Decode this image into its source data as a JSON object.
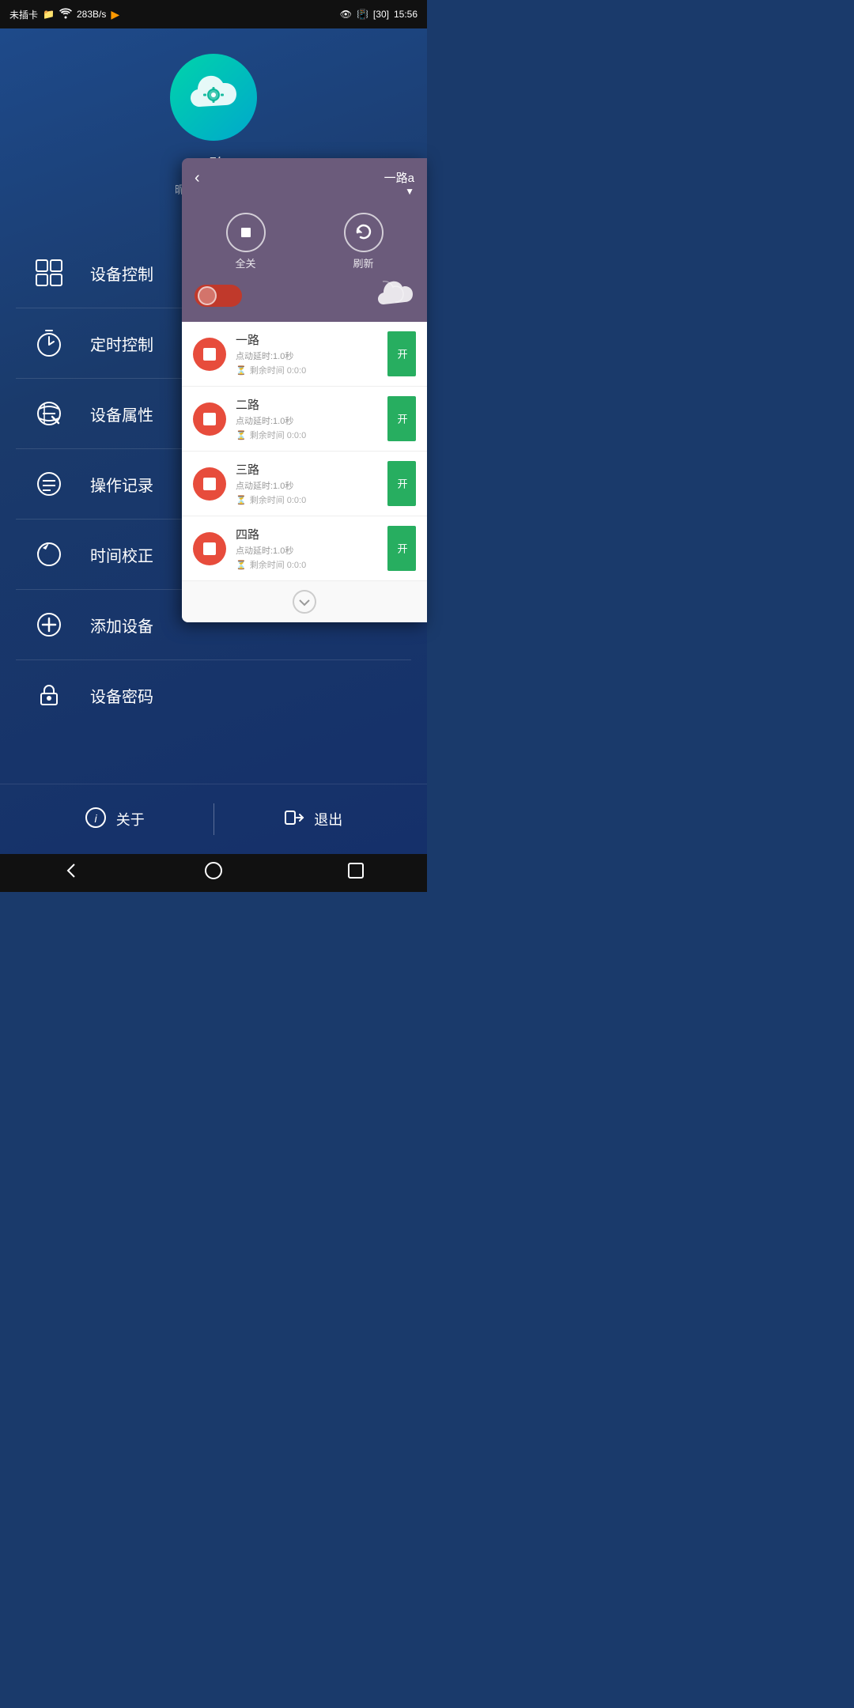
{
  "statusBar": {
    "left": "未插卡",
    "speed": "283B/s",
    "time": "15:56",
    "battery": "30"
  },
  "profile": {
    "name": "一路a",
    "nickname": "昵称：我的设备",
    "chevron": "∨"
  },
  "menuItems": [
    {
      "id": "device-control",
      "label": "设备控制"
    },
    {
      "id": "timer-control",
      "label": "定时控制"
    },
    {
      "id": "device-properties",
      "label": "设备属性"
    },
    {
      "id": "operation-log",
      "label": "操作记录"
    },
    {
      "id": "time-calibration",
      "label": "时间校正"
    },
    {
      "id": "add-device",
      "label": "添加设备"
    },
    {
      "id": "device-password",
      "label": "设备密码"
    }
  ],
  "bottomBar": {
    "aboutLabel": "关于",
    "logoutLabel": "退出"
  },
  "panel": {
    "title": "一路a",
    "allOffLabel": "全关",
    "refreshLabel": "刷新",
    "channels": [
      {
        "name": "一路",
        "delay": "点动延时:1.0秒",
        "remaining": "剩余时间 0:0:0",
        "onLabel": "开"
      },
      {
        "name": "二路",
        "delay": "点动延时:1.0秒",
        "remaining": "剩余时间 0:0:0",
        "onLabel": "开"
      },
      {
        "name": "三路",
        "delay": "点动延时:1.0秒",
        "remaining": "剩余时间 0:0:0",
        "onLabel": "开"
      },
      {
        "name": "四路",
        "delay": "点动延时:1.0秒",
        "remaining": "剩余时间 0:0:0",
        "onLabel": "开"
      }
    ]
  }
}
